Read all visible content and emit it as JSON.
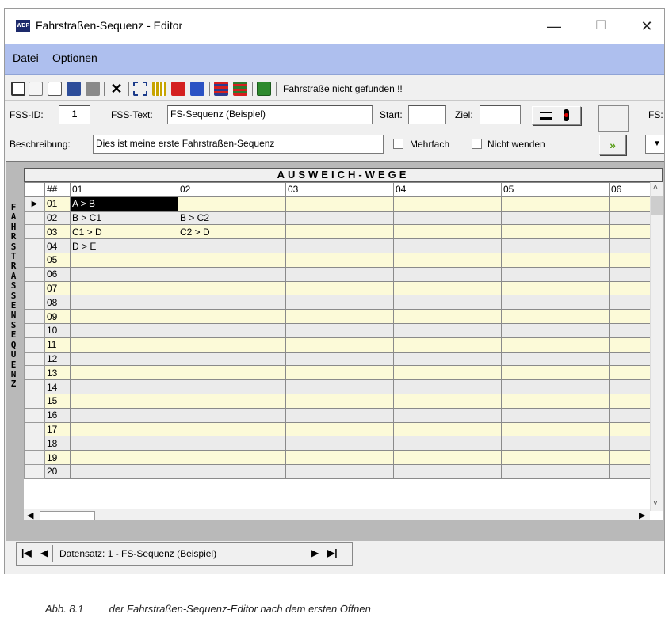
{
  "window": {
    "title": "Fahrstraßen-Sequenz - Editor",
    "minimize": "—",
    "maximize": "☐",
    "close": "✕"
  },
  "menu": [
    "Datei",
    "Optionen"
  ],
  "toolbar": {
    "message": "Fahrstraße nicht gefunden !!"
  },
  "form": {
    "fss_id_label": "FSS-ID:",
    "fss_id_value": "1",
    "fss_text_label": "FSS-Text:",
    "fss_text_value": "FS-Sequenz (Beispiel)",
    "start_label": "Start:",
    "start_value": "",
    "ziel_label": "Ziel:",
    "ziel_value": "",
    "fs_label": "FS:",
    "beschreibung_label": "Beschreibung:",
    "beschreibung_value": "Dies ist meine erste Fahrstraßen-Sequenz",
    "mehrfach_label": "Mehrfach",
    "nicht_wenden_label": "Nicht wenden"
  },
  "grid": {
    "title": "AUSWEICH-WEGE",
    "side_label": "FAHRSTRASSENSEQUENZ",
    "columns": [
      "##",
      "01",
      "02",
      "03",
      "04",
      "05",
      "06"
    ],
    "rows": [
      {
        "n": "01",
        "c1": "A > B",
        "c2": ""
      },
      {
        "n": "02",
        "c1": "B > C1",
        "c2": "B > C2"
      },
      {
        "n": "03",
        "c1": "C1 > D",
        "c2": "C2 > D"
      },
      {
        "n": "04",
        "c1": "D > E",
        "c2": ""
      },
      {
        "n": "05",
        "c1": "",
        "c2": ""
      },
      {
        "n": "06",
        "c1": "",
        "c2": ""
      },
      {
        "n": "07",
        "c1": "",
        "c2": ""
      },
      {
        "n": "08",
        "c1": "",
        "c2": ""
      },
      {
        "n": "09",
        "c1": "",
        "c2": ""
      },
      {
        "n": "10",
        "c1": "",
        "c2": ""
      },
      {
        "n": "11",
        "c1": "",
        "c2": ""
      },
      {
        "n": "12",
        "c1": "",
        "c2": ""
      },
      {
        "n": "13",
        "c1": "",
        "c2": ""
      },
      {
        "n": "14",
        "c1": "",
        "c2": ""
      },
      {
        "n": "15",
        "c1": "",
        "c2": ""
      },
      {
        "n": "16",
        "c1": "",
        "c2": ""
      },
      {
        "n": "17",
        "c1": "",
        "c2": ""
      },
      {
        "n": "18",
        "c1": "",
        "c2": ""
      },
      {
        "n": "19",
        "c1": "",
        "c2": ""
      },
      {
        "n": "20",
        "c1": "",
        "c2": ""
      }
    ]
  },
  "navigator": {
    "record_text": "Datensatz: 1 - FS-Sequenz (Beispiel)"
  },
  "caption": {
    "number": "Abb. 8.1",
    "text": "der Fahrstraßen-Sequenz-Editor nach dem ersten Öffnen"
  }
}
